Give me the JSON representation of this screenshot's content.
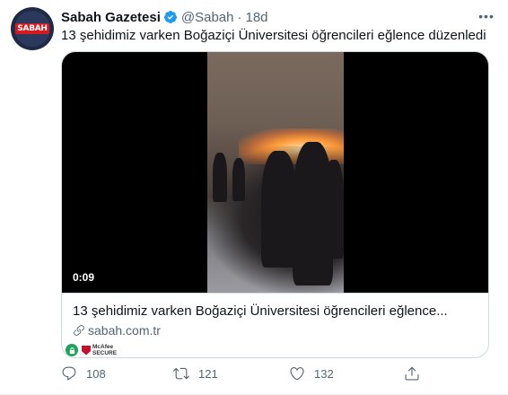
{
  "tweet": {
    "author_name": "Sabah Gazetesi",
    "handle": "@Sabah",
    "separator": "·",
    "time": "18d",
    "avatar_text": "SABAH",
    "text": "13 şehidimiz varken Boğaziçi Üniversitesi öğrencileri eğlence düzenledi",
    "more_label": "•••"
  },
  "card": {
    "video_duration": "0:09",
    "title": "13 şehidimiz varken Boğaziçi Üniversitesi öğrencileri eğlence...",
    "domain": "sabah.com.tr",
    "mcafee_line1": "McAfee",
    "mcafee_line2": "SECURE"
  },
  "actions": {
    "replies": "108",
    "retweets": "121",
    "likes": "132"
  },
  "colors": {
    "verified": "#1d9bf0",
    "secondary_text": "#536471",
    "border": "#cfd9de",
    "brand_red": "#d71920"
  }
}
